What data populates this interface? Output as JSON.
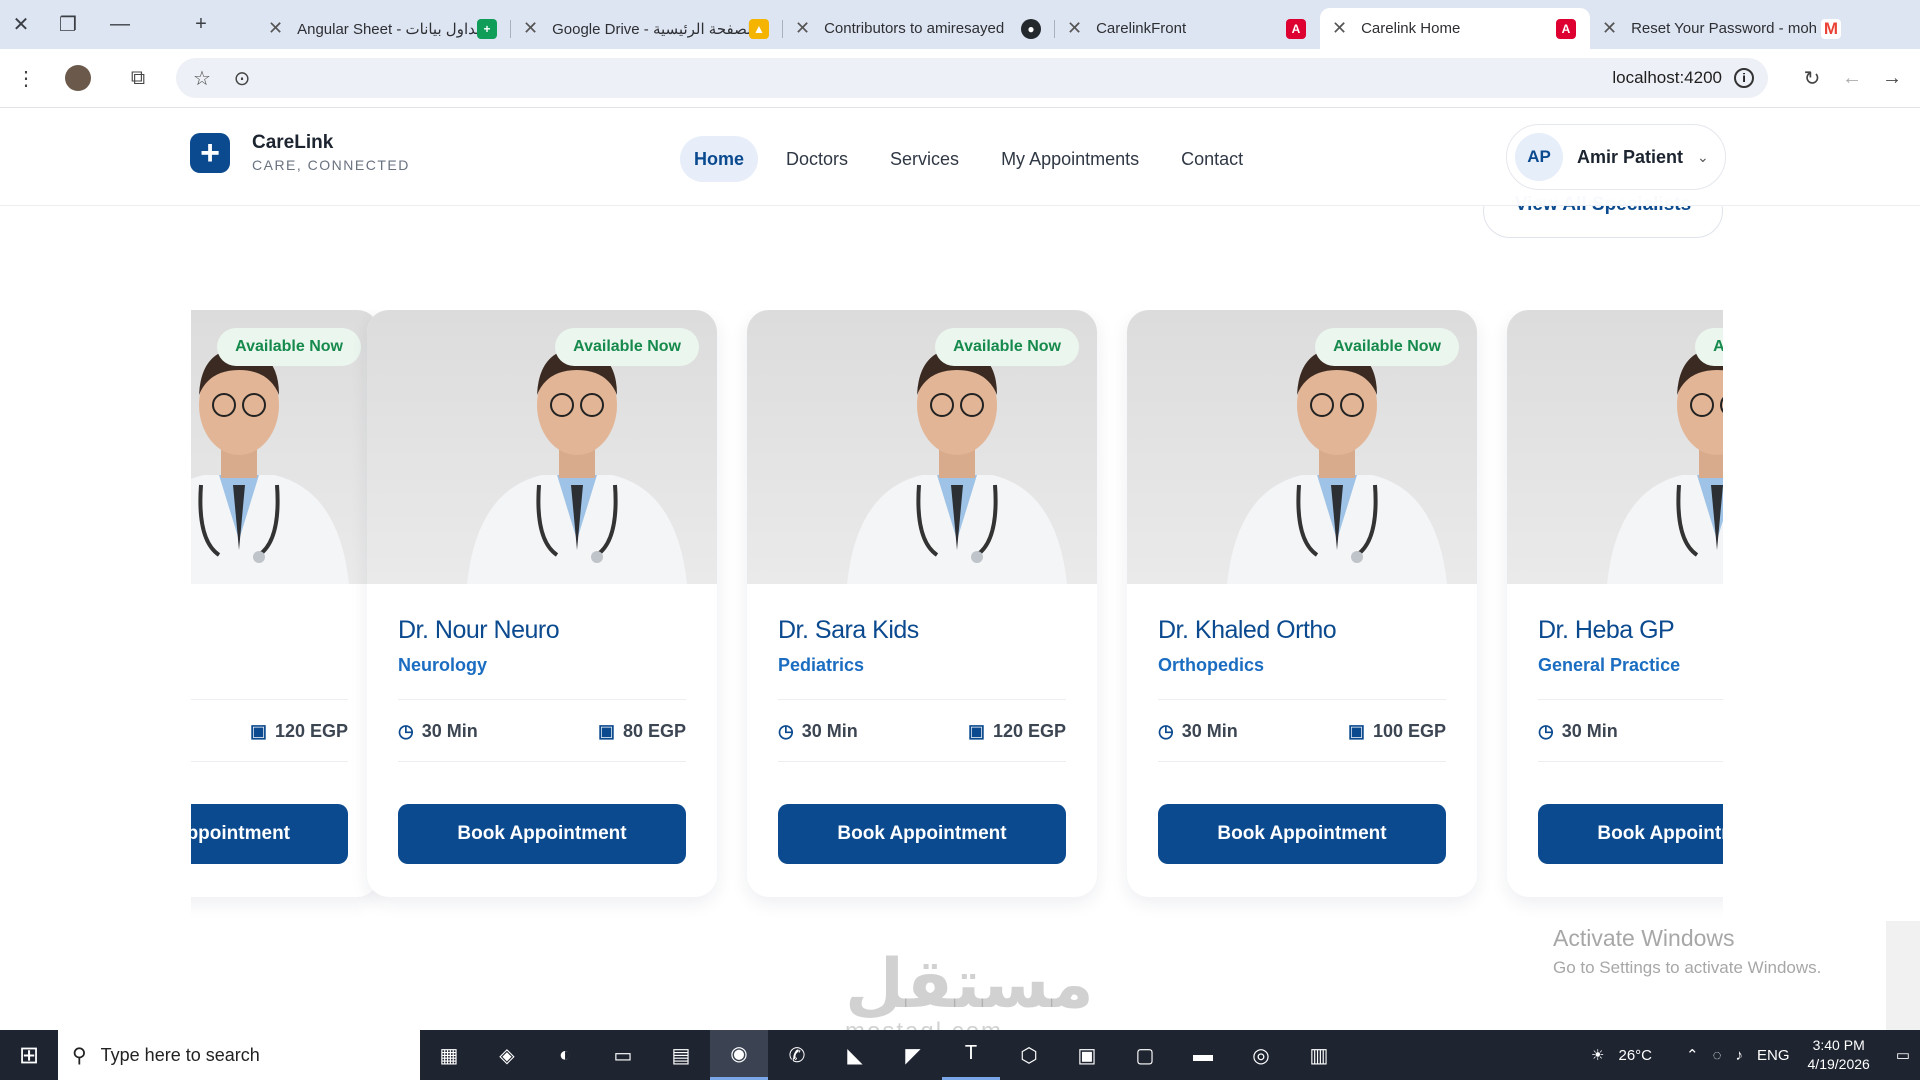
{
  "browser": {
    "tabs": [
      {
        "title": "Angular Sheet - جداول بيانات",
        "favicon": "sheets-icon",
        "color": "#0f9d58",
        "active": false
      },
      {
        "title": "Google Drive - الصفحة الرئيسية",
        "favicon": "drive-icon",
        "color": "#f4b400",
        "active": false
      },
      {
        "title": "Contributors to amiresayed",
        "favicon": "github-icon",
        "color": "#24292e",
        "active": false
      },
      {
        "title": "CarelinkFront",
        "favicon": "angular-icon",
        "color": "#dd0031",
        "active": false
      },
      {
        "title": "Carelink Home",
        "favicon": "angular-icon",
        "color": "#dd0031",
        "active": true
      },
      {
        "title": "Reset Your Password - moh",
        "favicon": "gmail-icon",
        "color": "#ea4335",
        "active": false
      }
    ],
    "url": "localhost:4200"
  },
  "site": {
    "brand_name": "CareLink",
    "brand_tagline": "CARE, CONNECTED",
    "nav": [
      {
        "label": "Home",
        "active": true
      },
      {
        "label": "Doctors",
        "active": false
      },
      {
        "label": "Services",
        "active": false
      },
      {
        "label": "My Appointments",
        "active": false
      },
      {
        "label": "Contact",
        "active": false
      }
    ],
    "user_initials": "AP",
    "user_name": "Amir Patient",
    "view_all_label": "View All Specialists"
  },
  "doctors": [
    {
      "name": "",
      "specialty": "",
      "duration": "",
      "price": "120 EGP",
      "badge": "Available Now",
      "button": "Book Appointment"
    },
    {
      "name": "Dr. Nour Neuro",
      "specialty": "Neurology",
      "duration": "30 Min",
      "price": "80 EGP",
      "badge": "Available Now",
      "button": "Book Appointment"
    },
    {
      "name": "Dr. Sara Kids",
      "specialty": "Pediatrics",
      "duration": "30 Min",
      "price": "120 EGP",
      "badge": "Available Now",
      "button": "Book Appointment"
    },
    {
      "name": "Dr. Khaled Ortho",
      "specialty": "Orthopedics",
      "duration": "30 Min",
      "price": "100 EGP",
      "badge": "Available Now",
      "button": "Book Appointment"
    },
    {
      "name": "Dr. Heba GP",
      "specialty": "General Practice",
      "duration": "30 Min",
      "price": "",
      "badge": "Available Now",
      "button": "Book Appointment"
    }
  ],
  "overlay": {
    "activate_title": "Activate Windows",
    "activate_sub": "Go to Settings to activate Windows.",
    "watermark": "مستقل",
    "watermark_sub": "mostaql.com"
  },
  "taskbar": {
    "search_placeholder": "Type here to search",
    "temperature": "26°C",
    "language": "ENG",
    "time": "3:40 PM",
    "date": "4/19/2026"
  }
}
